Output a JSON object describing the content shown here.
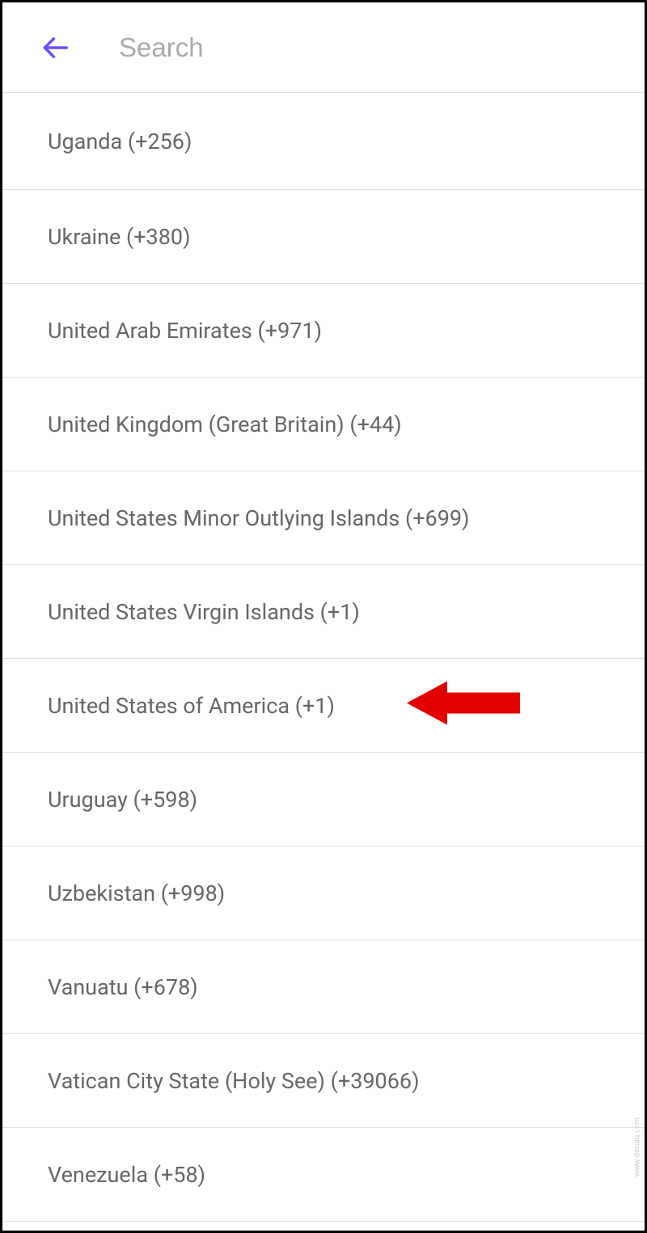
{
  "header": {
    "search_placeholder": "Search"
  },
  "countries": [
    {
      "label": "Uganda (+256)"
    },
    {
      "label": "Ukraine (+380)"
    },
    {
      "label": "United Arab Emirates (+971)"
    },
    {
      "label": "United Kingdom (Great Britain) (+44)"
    },
    {
      "label": "United States Minor Outlying Islands (+699)"
    },
    {
      "label": "United States Virgin Islands (+1)"
    },
    {
      "label": "United States of America (+1)",
      "annotated": true
    },
    {
      "label": "Uruguay (+598)"
    },
    {
      "label": "Uzbekistan (+998)"
    },
    {
      "label": "Vanuatu (+678)"
    },
    {
      "label": "Vatican City State (Holy See) (+39066)"
    },
    {
      "label": "Venezuela (+58)"
    }
  ],
  "colors": {
    "accent": "#6b4fff",
    "annotation": "#e30000"
  },
  "watermark": "www.deuaq.com"
}
